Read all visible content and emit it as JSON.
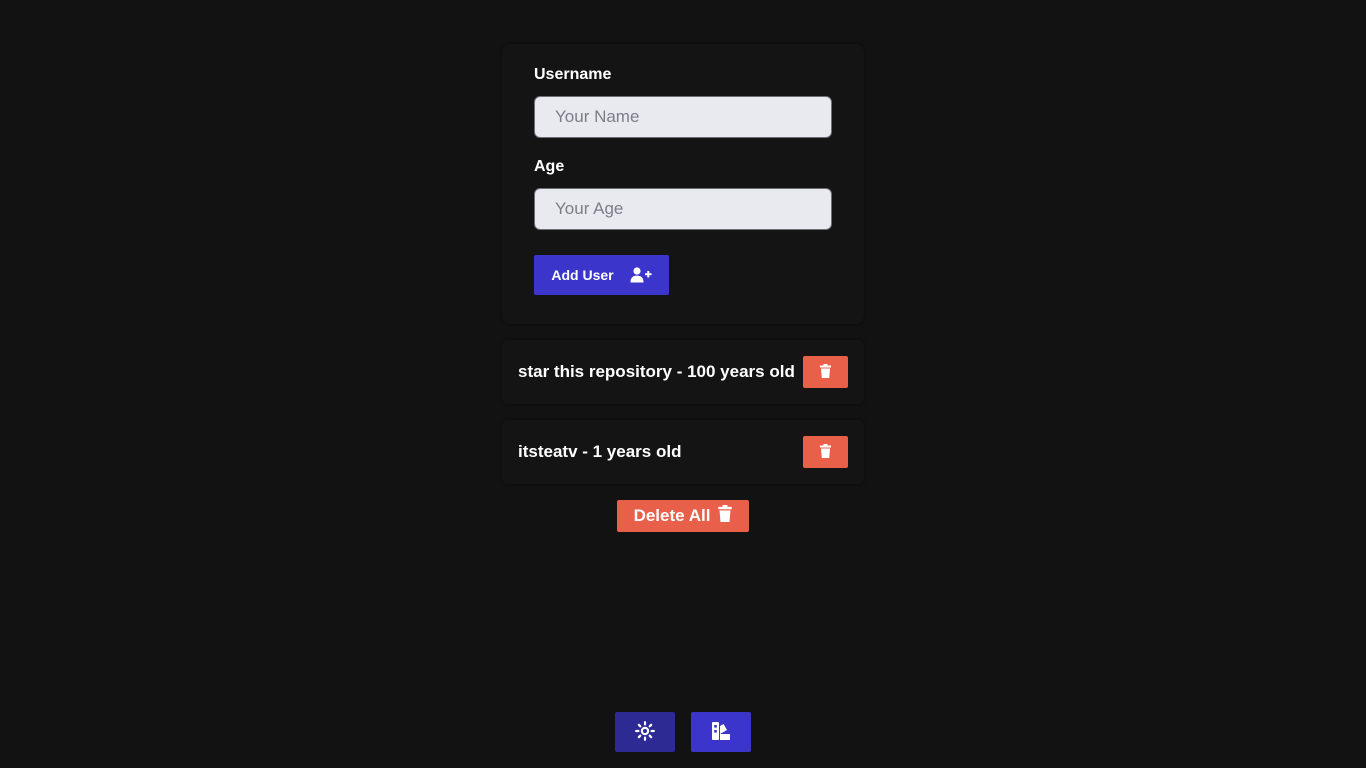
{
  "form": {
    "username_label": "Username",
    "username_placeholder": "Your Name",
    "username_value": "",
    "age_label": "Age",
    "age_placeholder": "Your Age",
    "age_value": "",
    "add_button_label": "Add User",
    "add_button_icon": "user-plus-icon"
  },
  "users": [
    {
      "text": "star this repository - 100 years old",
      "delete_icon": "trash-icon"
    },
    {
      "text": "itsteatv - 1 years old",
      "delete_icon": "trash-icon"
    }
  ],
  "delete_all": {
    "label": "Delete All",
    "icon": "trash-icon"
  },
  "footer": {
    "theme_icon": "sun-icon",
    "palette_icon": "swatchbook-icon"
  },
  "colors": {
    "background": "#121212",
    "primary": "#3b35cc",
    "primary_dark": "#2d2a94",
    "danger": "#e8604a",
    "input_bg": "#e9e9f0"
  }
}
